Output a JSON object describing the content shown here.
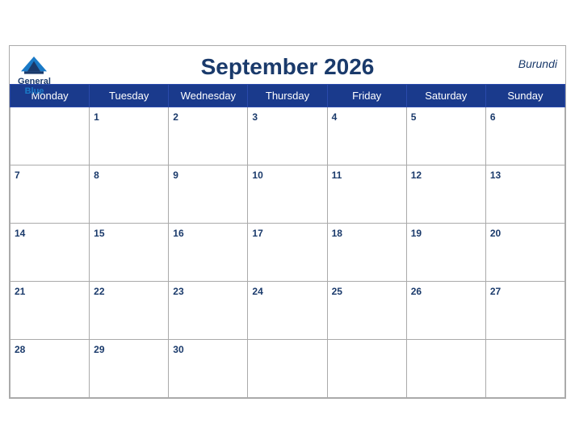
{
  "header": {
    "title": "September 2026",
    "country": "Burundi",
    "logo": {
      "general": "General",
      "blue": "Blue"
    }
  },
  "weekdays": [
    "Monday",
    "Tuesday",
    "Wednesday",
    "Thursday",
    "Friday",
    "Saturday",
    "Sunday"
  ],
  "weeks": [
    [
      null,
      1,
      2,
      3,
      4,
      5,
      6
    ],
    [
      7,
      8,
      9,
      10,
      11,
      12,
      13
    ],
    [
      14,
      15,
      16,
      17,
      18,
      19,
      20
    ],
    [
      21,
      22,
      23,
      24,
      25,
      26,
      27
    ],
    [
      28,
      29,
      30,
      null,
      null,
      null,
      null
    ]
  ],
  "colors": {
    "header_bg": "#1a3a8c",
    "title_color": "#1a3a6b",
    "border": "#aaaaaa"
  }
}
